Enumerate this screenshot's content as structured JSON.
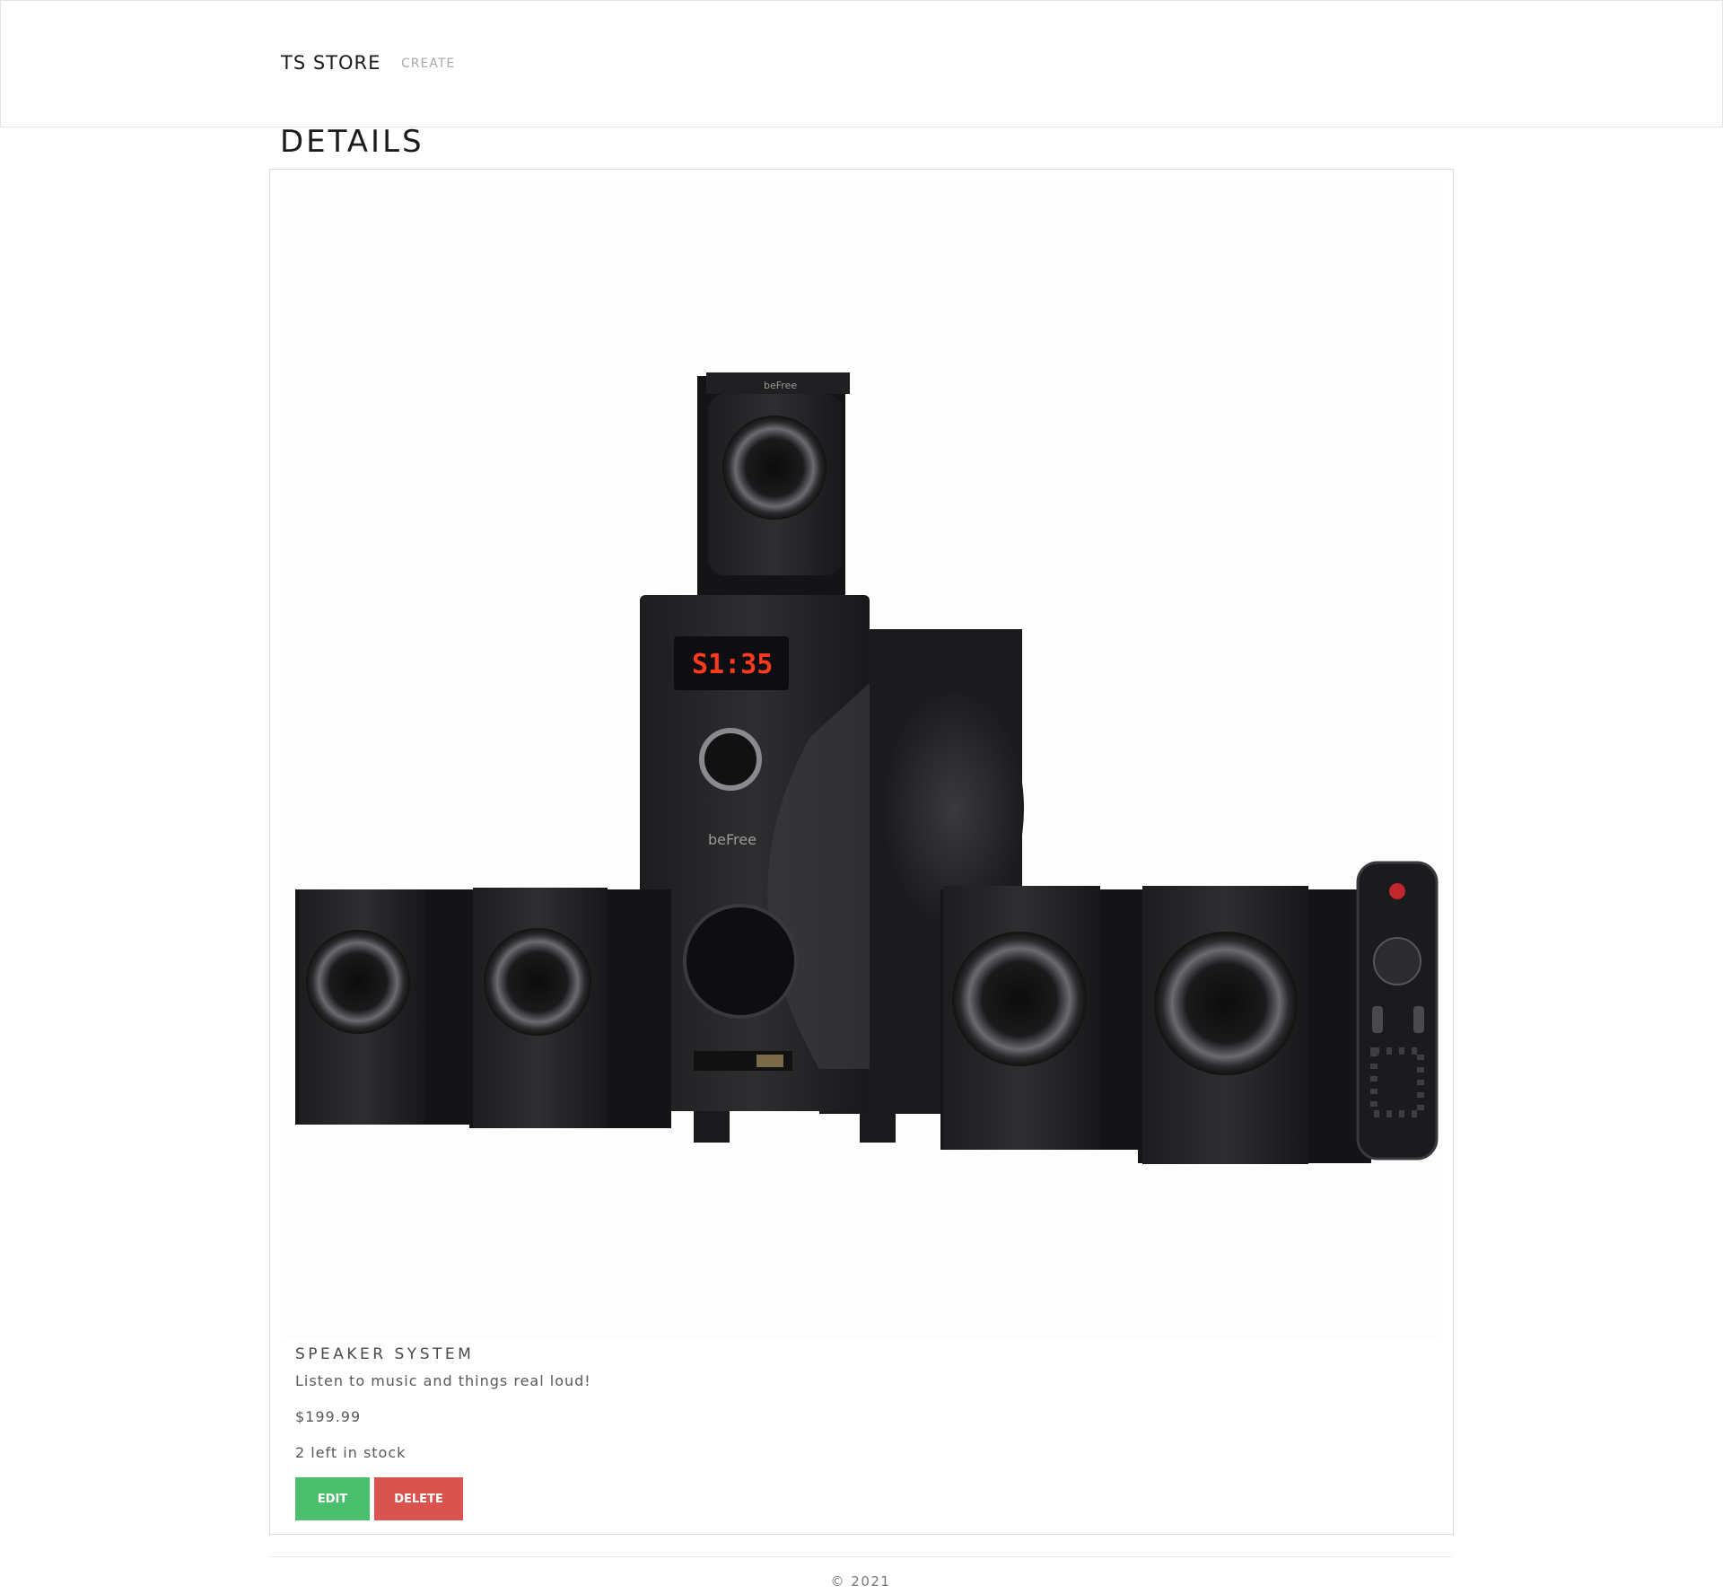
{
  "nav": {
    "brand": "TS STORE",
    "links": [
      {
        "label": "CREATE"
      }
    ]
  },
  "page": {
    "title": "DETAILS"
  },
  "product": {
    "image_alt": "speaker-system-product-photo",
    "name": "SPEAKER SYSTEM",
    "description": "Listen to music and things real loud!",
    "price": "$199.99",
    "stock": "2 left in stock",
    "display_text": "S1:35",
    "brand_mark": "beFree"
  },
  "actions": {
    "edit_label": "EDIT",
    "delete_label": "DELETE"
  },
  "footer": {
    "text": "© 2021"
  },
  "colors": {
    "edit_button": "#4cbf6e",
    "delete_button": "#d9534f",
    "nav_link": "#a9a9a9"
  }
}
